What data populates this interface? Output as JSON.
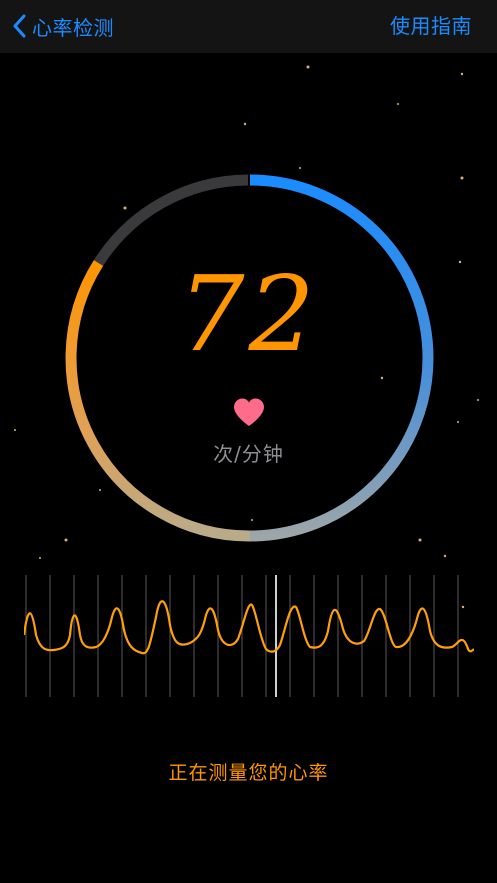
{
  "nav": {
    "back_label": "心率检测",
    "guide_label": "使用指南"
  },
  "heart_rate": {
    "value": "72",
    "unit": "次/分钟"
  },
  "status_text": "正在测量您的心率",
  "icons": {
    "back": "chevron-left-icon",
    "heart": "heart-icon"
  },
  "colors": {
    "accent_blue": "#1a8cff",
    "accent_orange": "#ff9500",
    "heart_pink": "#ff6b8a",
    "ring_track": "#3a3a3c",
    "unit_gray": "#8e8e93"
  }
}
